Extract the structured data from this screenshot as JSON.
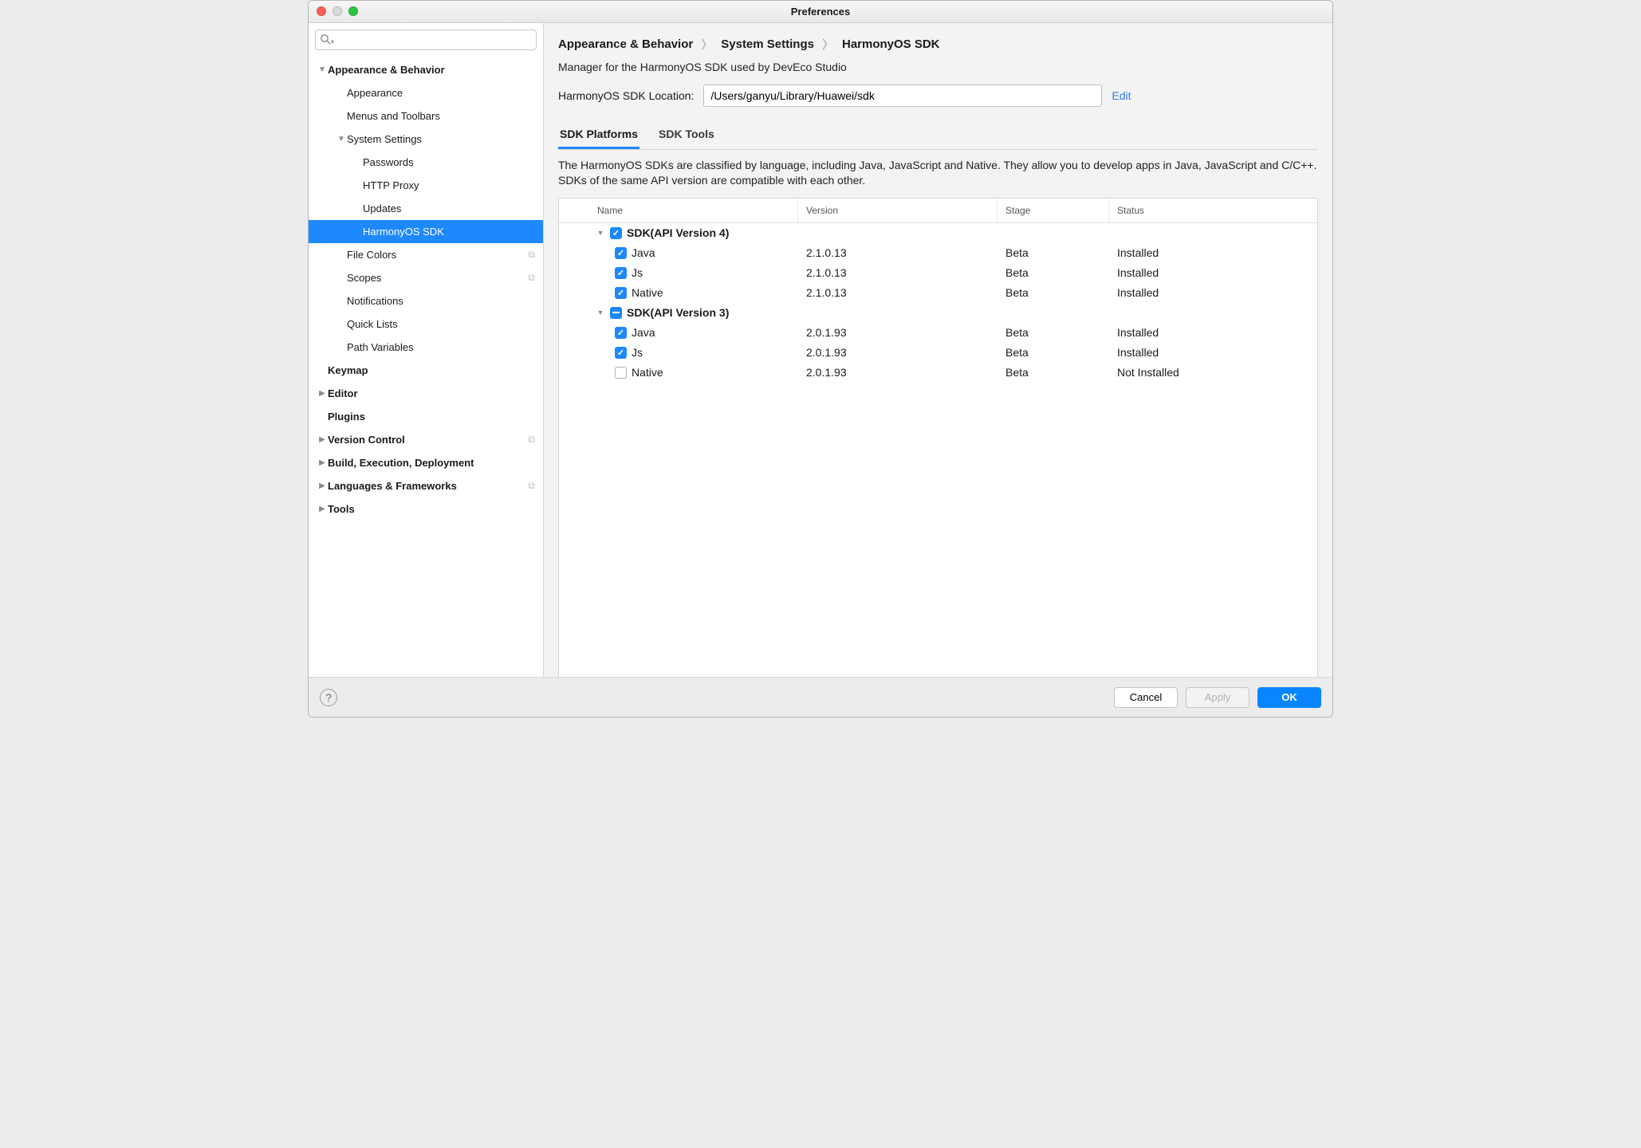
{
  "window": {
    "title": "Preferences"
  },
  "search": {
    "placeholder": ""
  },
  "sidebar": {
    "items": [
      {
        "label": "Appearance & Behavior",
        "bold": true,
        "indent": 0,
        "arrow": "down"
      },
      {
        "label": "Appearance",
        "indent": 1
      },
      {
        "label": "Menus and Toolbars",
        "indent": 1
      },
      {
        "label": "System Settings",
        "indent": 1,
        "arrow": "down"
      },
      {
        "label": "Passwords",
        "indent": 2
      },
      {
        "label": "HTTP Proxy",
        "indent": 2
      },
      {
        "label": "Updates",
        "indent": 2
      },
      {
        "label": "HarmonyOS SDK",
        "indent": 2,
        "selected": true
      },
      {
        "label": "File Colors",
        "indent": 1,
        "copy": true
      },
      {
        "label": "Scopes",
        "indent": 1,
        "copy": true
      },
      {
        "label": "Notifications",
        "indent": 1
      },
      {
        "label": "Quick Lists",
        "indent": 1
      },
      {
        "label": "Path Variables",
        "indent": 1
      },
      {
        "label": "Keymap",
        "bold": true,
        "indent": 0
      },
      {
        "label": "Editor",
        "bold": true,
        "indent": 0,
        "arrow": "right"
      },
      {
        "label": "Plugins",
        "bold": true,
        "indent": 0
      },
      {
        "label": "Version Control",
        "bold": true,
        "indent": 0,
        "arrow": "right",
        "copy": true
      },
      {
        "label": "Build, Execution, Deployment",
        "bold": true,
        "indent": 0,
        "arrow": "right"
      },
      {
        "label": "Languages & Frameworks",
        "bold": true,
        "indent": 0,
        "arrow": "right",
        "copy": true
      },
      {
        "label": "Tools",
        "bold": true,
        "indent": 0,
        "arrow": "right"
      }
    ]
  },
  "breadcrumb": {
    "a": "Appearance & Behavior",
    "b": "System Settings",
    "c": "HarmonyOS SDK"
  },
  "header": {
    "manager_text": "Manager for the HarmonyOS SDK used by DevEco Studio",
    "location_label": "HarmonyOS SDK Location:",
    "location_value": "/Users/ganyu/Library/Huawei/sdk",
    "edit_label": "Edit"
  },
  "tabs": {
    "platforms": "SDK Platforms",
    "tools": "SDK Tools"
  },
  "help_text": "The HarmonyOS SDKs are classified by language, including Java, JavaScript and Native. They allow you to develop apps in Java, JavaScript and C/C++. SDKs of the same API version are compatible with each other.",
  "table": {
    "headers": {
      "name": "Name",
      "version": "Version",
      "stage": "Stage",
      "status": "Status"
    },
    "groups": [
      {
        "name": "SDK(API Version 4)",
        "check": "checked",
        "rows": [
          {
            "name": "Java",
            "version": "2.1.0.13",
            "stage": "Beta",
            "status": "Installed",
            "check": "checked"
          },
          {
            "name": "Js",
            "version": "2.1.0.13",
            "stage": "Beta",
            "status": "Installed",
            "check": "checked"
          },
          {
            "name": "Native",
            "version": "2.1.0.13",
            "stage": "Beta",
            "status": "Installed",
            "check": "checked"
          }
        ]
      },
      {
        "name": "SDK(API Version 3)",
        "check": "partial",
        "rows": [
          {
            "name": "Java",
            "version": "2.0.1.93",
            "stage": "Beta",
            "status": "Installed",
            "check": "checked"
          },
          {
            "name": "Js",
            "version": "2.0.1.93",
            "stage": "Beta",
            "status": "Installed",
            "check": "checked"
          },
          {
            "name": "Native",
            "version": "2.0.1.93",
            "stage": "Beta",
            "status": "Not Installed",
            "check": "unchecked"
          }
        ]
      }
    ]
  },
  "footer": {
    "cancel": "Cancel",
    "apply": "Apply",
    "ok": "OK"
  }
}
